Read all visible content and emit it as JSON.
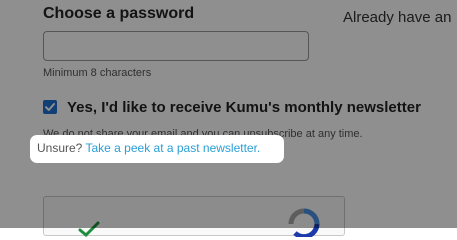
{
  "signup": {
    "password_label": "Choose a password",
    "password_value": "",
    "password_hint": "Minimum 8 characters",
    "newsletter_label": "Yes, I'd like to receive Kumu's monthly newsletter",
    "newsletter_checked": true,
    "privacy_note": "We do not share your email and you can unsubscribe at any time.",
    "unsure_text": "Unsure?",
    "newsletter_link_text": "Take a peek at a past newsletter."
  },
  "aside": {
    "text": "Already have an"
  },
  "captcha": {
    "icons": [
      "checkmark-icon",
      "recaptcha-logo-icon"
    ]
  },
  "colors": {
    "accent": "#1f6fd0",
    "link": "#2a9fd6",
    "overlay": "rgba(0,0,0,0.44)"
  }
}
